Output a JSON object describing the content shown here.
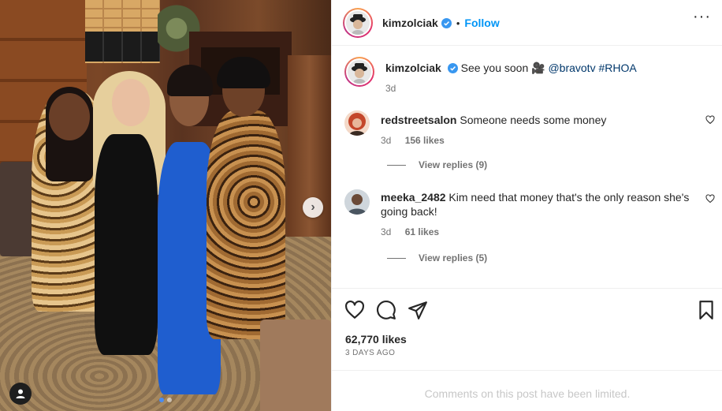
{
  "post": {
    "author": "kimzolciak",
    "follow_label": "Follow",
    "separator": "•",
    "more_icon": "more-horizontal-icon",
    "caption_text": "See you soon 🎥",
    "caption_mention": "@bravotv",
    "caption_hashtag": "#RHOA",
    "caption_age": "3d",
    "likes": "62,770 likes",
    "date": "3 DAYS AGO",
    "comments_limited": "Comments on this post have been limited."
  },
  "comments": [
    {
      "username": "redstreetsalon",
      "text": "Someone needs some money",
      "age": "3d",
      "likes": "156 likes",
      "replies": "View replies (9)"
    },
    {
      "username": "meeka_2482",
      "text": "Kim need that money that's the only reason she's going back!",
      "age": "3d",
      "likes": "61 likes",
      "replies": "View replies (5)"
    }
  ],
  "carousel": {
    "current": 1,
    "total": 2
  },
  "colors": {
    "accent": "#0095f6",
    "verified": "#3897f0",
    "link": "#00376b",
    "muted": "#737373"
  }
}
